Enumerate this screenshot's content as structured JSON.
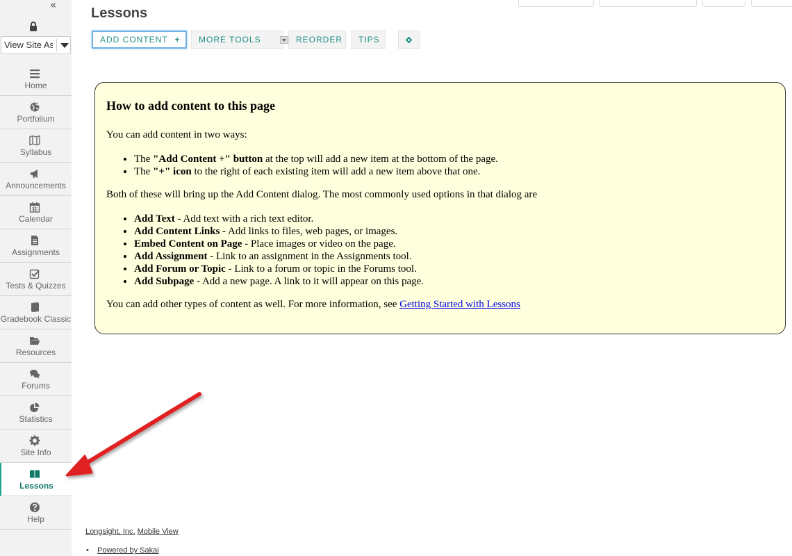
{
  "sidebar": {
    "collapse_icon": "collapse-sidebar-icon",
    "view_site_as": "View Site As",
    "items": [
      {
        "label": "Home",
        "icon": "list-icon"
      },
      {
        "label": "Portfolium",
        "icon": "globe-icon"
      },
      {
        "label": "Syllabus",
        "icon": "map-icon"
      },
      {
        "label": "Announcements",
        "icon": "megaphone-icon"
      },
      {
        "label": "Calendar",
        "icon": "calendar-icon"
      },
      {
        "label": "Assignments",
        "icon": "document-icon"
      },
      {
        "label": "Tests & Quizzes",
        "icon": "checkbox-icon"
      },
      {
        "label": "Gradebook Classic",
        "icon": "book-icon"
      },
      {
        "label": "Resources",
        "icon": "folder-icon"
      },
      {
        "label": "Forums",
        "icon": "chat-icon"
      },
      {
        "label": "Statistics",
        "icon": "pie-chart-icon"
      },
      {
        "label": "Site Info",
        "icon": "gear-icon"
      },
      {
        "label": "Lessons",
        "icon": "open-book-icon",
        "active": true
      },
      {
        "label": "Help",
        "icon": "question-icon"
      }
    ]
  },
  "main": {
    "title": "Lessons",
    "toolbar": {
      "add_content": "ADD CONTENT",
      "add_plus": "+",
      "more_tools": "MORE TOOLS",
      "reorder": "REORDER",
      "tips": "TIPS",
      "settings_icon": "gear-icon"
    }
  },
  "instructions": {
    "heading": "How to add content to this page",
    "intro": "You can add content in two ways:",
    "ways": [
      {
        "bold": "\"Add Content +\" button",
        "prefix": "The ",
        "rest": " at the top will add a new item at the bottom of the page."
      },
      {
        "bold": "\"+\" icon",
        "prefix": "The ",
        "rest": " to the right of each existing item will add a new item above that one."
      }
    ],
    "dialog_text": "Both of these will bring up the Add Content dialog. The most commonly used options in that dialog are",
    "options": [
      {
        "bold": "Add Text",
        "rest": " - Add text with a rich text editor."
      },
      {
        "bold": "Add Content Links",
        "rest": " - Add links to files, web pages, or images."
      },
      {
        "bold": "Embed Content on Page",
        "rest": " - Place images or video on the page."
      },
      {
        "bold": "Add Assignment",
        "rest": " - Link to an assignment in the Assignments tool."
      },
      {
        "bold": "Add Forum or Topic",
        "rest": " - Link to a forum or topic in the Forums tool."
      },
      {
        "bold": "Add Subpage",
        "rest": " - Add a new page. A link to it will appear on this page."
      }
    ],
    "more_text": "You can add other types of content as well. For more information, see ",
    "more_link": "Getting Started with Lessons"
  },
  "footer": {
    "company": "Longsight, Inc.",
    "mobile": "Mobile View",
    "powered": "Powered by Sakai"
  },
  "colors": {
    "accent": "#1ea28c",
    "box_background": "#ffffdd",
    "arrow": "#e02020"
  }
}
